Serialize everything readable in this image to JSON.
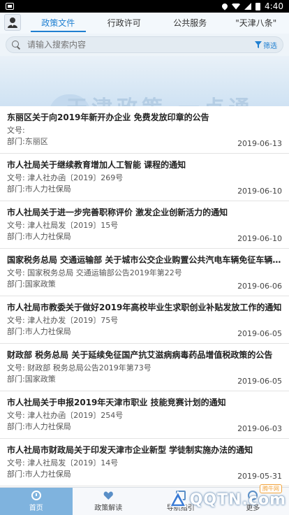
{
  "status_bar": {
    "time": "4:40"
  },
  "header": {
    "tabs": [
      {
        "label": "政策文件",
        "active": true
      },
      {
        "label": "行政许可",
        "active": false
      },
      {
        "label": "公共服务",
        "active": false
      },
      {
        "label": "\"天津八条\"",
        "active": false
      }
    ]
  },
  "search": {
    "placeholder": "请输入搜索内容",
    "filter_label": "筛选"
  },
  "banner": {
    "text": "天津政策 一点通"
  },
  "items": [
    {
      "title": "东丽区关于向2019年新开办企业 免费发放印章的公告",
      "docno": "文号:",
      "dept": "部门:东丽区",
      "date": "2019-06-13"
    },
    {
      "title": "市人社局关于继续教育增加人工智能 课程的通知",
      "docno": "文号: 津人社办函〔2019〕269号",
      "dept": "部门:市人力社保局",
      "date": "2019-06-10"
    },
    {
      "title": "市人社局关于进一步完善职称评价 激发企业创新活力的通知",
      "docno": "文号: 津人社局发〔2019〕15号",
      "dept": "部门:市人力社保局",
      "date": "2019-06-10"
    },
    {
      "title": "国家税务总局 交通运输部 关于城市公交企业购置公共汽电车辆免征车辆购置税...",
      "docno": "文号: 国家税务总局 交通运输部公告2019年第22号",
      "dept": "部门:国家政策",
      "date": "2019-06-06"
    },
    {
      "title": "市人社局市教委关于做好2019年高校毕业生求职创业补贴发放工作的通知",
      "docno": "文号: 津人社办发〔2019〕75号",
      "dept": "部门:市人力社保局",
      "date": "2019-06-05"
    },
    {
      "title": "财政部 税务总局 关于延续免征国产抗艾滋病病毒药品增值税政策的公告",
      "docno": "文号: 财政部 税务总局公告2019年第73号",
      "dept": "部门:国家政策",
      "date": "2019-06-05"
    },
    {
      "title": "市人社局关于申报2019年天津市职业 技能竞赛计划的通知",
      "docno": "文号: 津人社办函〔2019〕254号",
      "dept": "部门:市人力社保局",
      "date": "2019-06-03"
    },
    {
      "title": "市人社局市财政局关于印发天津市企业新型 学徒制实施办法的通知",
      "docno": "文号: 津人社局发〔2019〕14号",
      "dept": "部门:市人力社保局",
      "date": "2019-05-31"
    }
  ],
  "bottom_nav": [
    {
      "label": "首页",
      "icon": "clock-icon",
      "active": true
    },
    {
      "label": "政策解读",
      "icon": "heart-icon",
      "active": false
    },
    {
      "label": "导航指引",
      "icon": "guide-icon",
      "active": false
    },
    {
      "label": "更多",
      "icon": "more-icon",
      "active": false
    }
  ],
  "watermark": {
    "text": "QQTN.com",
    "badge": "腾牛网"
  }
}
